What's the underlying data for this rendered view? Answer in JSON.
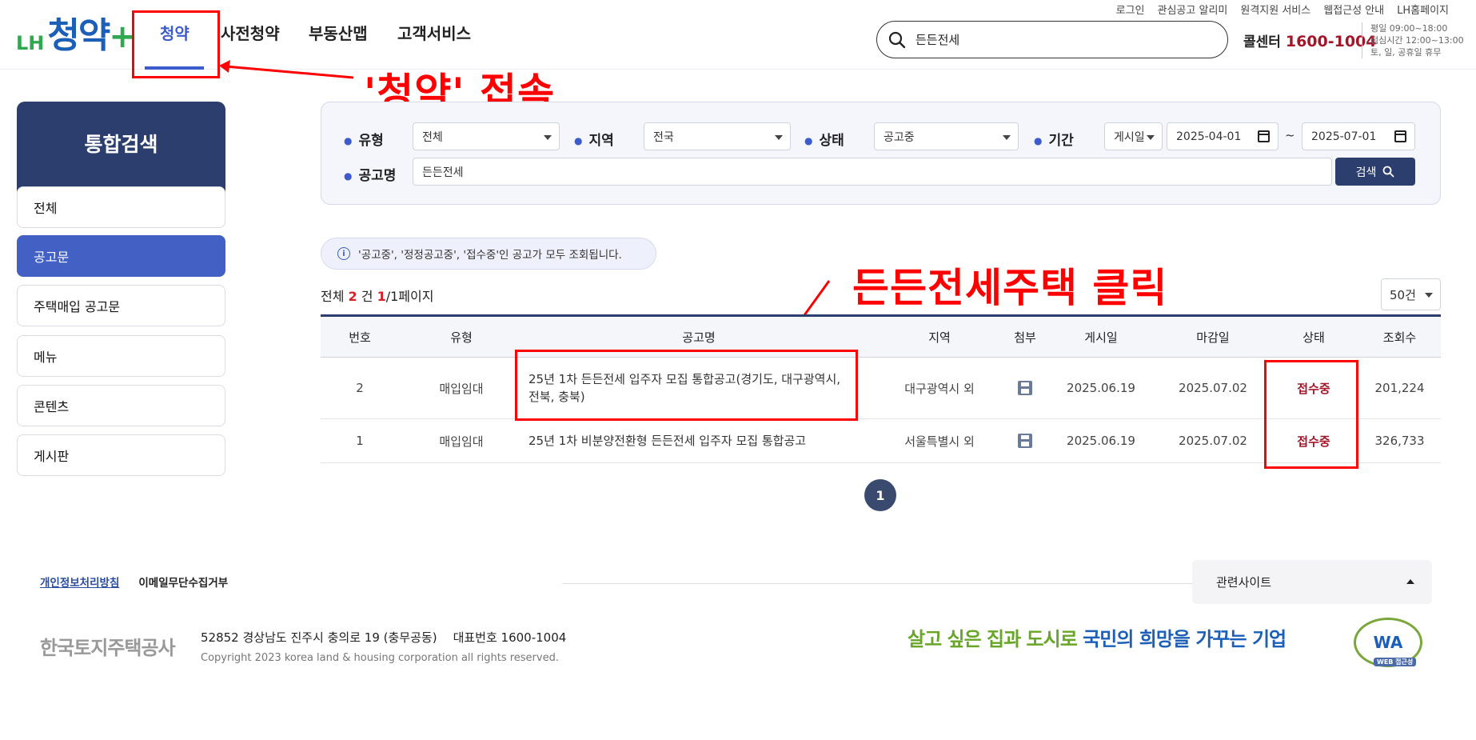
{
  "header": {
    "logo": {
      "lh": "LH",
      "name": "청약",
      "plus": "+"
    },
    "nav": [
      "청약",
      "사전청약",
      "부동산맵",
      "고객서비스"
    ],
    "util_links": [
      "로그인",
      "관심공고 알리미",
      "원격지원 서비스",
      "웹접근성 안내",
      "LH홈페이지"
    ],
    "search_value": "든든전세",
    "callcenter": {
      "label": "콜센터",
      "number": "1600-1004"
    },
    "hours": "평일 09:00~18:00\n점심시간 12:00~13:00\n토, 일, 공휴일 휴무"
  },
  "annotations": {
    "connect_text": "'청약' 접속",
    "click_text": "든든전세주택 클릭",
    "color": "#ff0000"
  },
  "sidebar": {
    "title": "통합검색",
    "items": [
      "전체",
      "공고문",
      "주택매입 공고문",
      "메뉴",
      "콘텐츠",
      "게시판"
    ],
    "active": "공고문"
  },
  "filter": {
    "type_label": "유형",
    "type_value": "전체",
    "region_label": "지역",
    "region_value": "전국",
    "status_label": "상태",
    "status_value": "공고중",
    "period_label": "기간",
    "period_type": "게시일",
    "date_from": "2025-04-01",
    "date_sep": "~",
    "date_to": "2025-07-01",
    "title_label": "공고명",
    "title_value": "든든전세",
    "search_button": "검색"
  },
  "info_text": "'공고중', '정정공고중', '접수중'인 공고가 모두 조회됩니다.",
  "count": {
    "prefix": "전체 ",
    "total": "2",
    "unit": " 건 ",
    "page": "1",
    "pages": "/1페이지"
  },
  "page_size": "50건",
  "table": {
    "headers": [
      "번호",
      "유형",
      "공고명",
      "지역",
      "첨부",
      "게시일",
      "마감일",
      "상태",
      "조회수"
    ],
    "rows": [
      {
        "no": "2",
        "type": "매입임대",
        "title": "25년 1차 든든전세 입주자 모집 통합공고(경기도, 대구광역시, 전북, 충북)",
        "region": "대구광역시 외",
        "attach": "floppy-disk-icon",
        "posted": "2025.06.19",
        "deadline": "2025.07.02",
        "status": "접수중",
        "views": "201,224"
      },
      {
        "no": "1",
        "type": "매입임대",
        "title": "25년 1차 비분양전환형 든든전세 입주자 모집 통합공고",
        "region": "서울특별시 외",
        "attach": "floppy-disk-icon",
        "posted": "2025.06.19",
        "deadline": "2025.07.02",
        "status": "접수중",
        "views": "326,733"
      }
    ]
  },
  "pagination": {
    "current": "1"
  },
  "footer": {
    "privacy": "개인정보처리방침",
    "email_policy": "이메일무단수집거부",
    "related": "관련사이트",
    "corp_name": "한국토지주택공사",
    "address": "52852 경상남도 진주시 충의로 19 (충무공동)",
    "tel": "대표번호 1600-1004",
    "copyright": "Copyright 2023 korea land & housing corporation all rights reserved.",
    "slogan_1": "살고 싶은 집과 도시로 ",
    "slogan_2": "국민의 희망을 가꾸는 기업",
    "wa_mark": "WA",
    "wa_web": "WEB 접근성"
  }
}
